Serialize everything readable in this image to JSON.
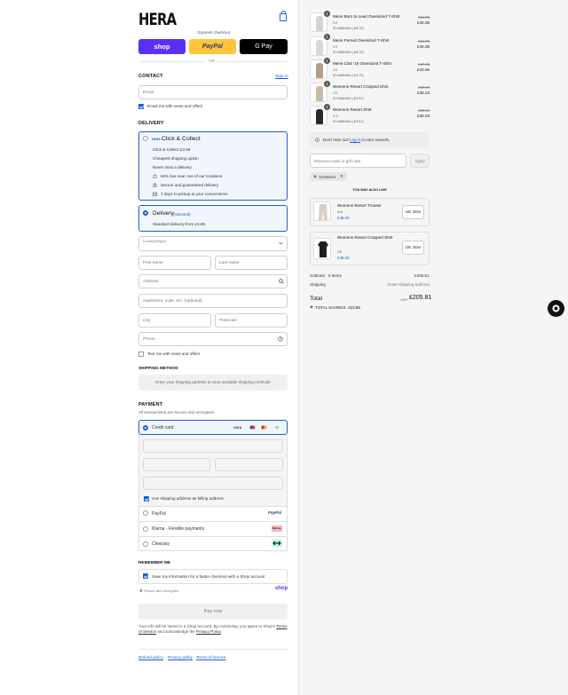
{
  "brand": {
    "logo": "HERA"
  },
  "express": {
    "label": "Express checkout",
    "shop": "shop",
    "paypal": "PayPal",
    "gpay": "G Pay",
    "or": "OR"
  },
  "contact": {
    "title": "CONTACT",
    "sign_in": "Sign in",
    "email_placeholder": "Email",
    "news_label": "Email me with news and offers"
  },
  "delivery": {
    "title": "DELIVERY",
    "cc": {
      "badge": "HERA",
      "label": "Click & Collect",
      "lines": [
        "Click & Collect £3.99",
        "Cheapest shipping option",
        "Never miss a delivery"
      ],
      "features": [
        "94% live near one of our locations",
        "Secure and guaranteed delivery",
        "7 days to pickup at your convenience"
      ]
    },
    "del": {
      "label": "Delivery",
      "selected": "(selected)",
      "line": "Standard delivery from £3.89"
    },
    "country_label": "Country/Region",
    "first_name": "First name",
    "last_name": "Last name",
    "address": "Address",
    "apartment": "Apartment, suite, etc. (optional)",
    "city": "City",
    "postcode": "Postcode",
    "phone": "Phone",
    "text_me": "Text me with news and offers"
  },
  "shipping": {
    "title": "SHIPPING METHOD",
    "msg": "Enter your shipping address to view available shipping methods"
  },
  "payment": {
    "title": "PAYMENT",
    "subtitle": "All transactions are secure and encrypted.",
    "credit_card": "Credit card",
    "more_cards": "+5",
    "billing_label": "Use shipping address as billing address",
    "paypal": "PayPal",
    "paypal_logo": "PayPal",
    "klarna": "Klarna - Flexible payments",
    "klarna_logo": "Klarna.",
    "clearpay": "Clearpay"
  },
  "remember": {
    "title": "REMEMBER ME",
    "save_label": "Save my information for a faster checkout with a Shop account",
    "secure": "Secure and encrypted",
    "shop": "shop"
  },
  "pay_now": "Pay now",
  "legal": {
    "text1": "Your info will be saved to a Shop account. By continuing, you agree to Shop's",
    "tos": "Terms of Service",
    "text2": "and acknowledge the",
    "privacy": "Privacy Policy",
    "dot": "."
  },
  "footer": {
    "refund": "Refund policy",
    "privacy": "Privacy policy",
    "terms": "Terms of service"
  },
  "cart": {
    "items": [
      {
        "qty": "1",
        "name": "Mens Born to Lead Oversized T-Shirt",
        "size": "XS",
        "old": "£51.95",
        "price": "£46.35",
        "discount": "HANNAH (-£5.70)"
      },
      {
        "qty": "1",
        "name": "Mens Pursuit Oversized T-Shirt",
        "size": "XS",
        "old": "£51.95",
        "price": "£46.35",
        "discount": "HANNAH (-£5.70)"
      },
      {
        "qty": "1",
        "name": "Mens Club '15 Oversized T-Shirt",
        "size": "XS",
        "old": "£47.35",
        "price": "£42.65",
        "discount": "HANNAH (-£4.70)"
      },
      {
        "qty": "1",
        "name": "Womens Resort Cropped Shirt",
        "size": "XS",
        "old": "£39.14",
        "price": "£35.23",
        "discount": "HANNAH (-£3.91)"
      },
      {
        "qty": "1",
        "name": "Womens Resort Shirt",
        "size": "6-8",
        "old": "£39.14",
        "price": "£35.23",
        "discount": "HANNAH (-£3.91)"
      }
    ],
    "rewards": {
      "pre": "Don't miss out!",
      "link": "Log in",
      "post": "to earn rewards."
    },
    "discount_placeholder": "Discount code or gift card",
    "apply": "Apply",
    "code_tag": "HANNAH",
    "also_like": "YOU MAY ALSO LIKE",
    "recs": [
      {
        "name": "Womens Resort Trouser",
        "size": "6-8",
        "price": "£48.00",
        "btn": "UK Size"
      },
      {
        "name": "Womens Resort Cropped Shirt",
        "size": "XS",
        "price": "£38.00",
        "btn": "UK Size"
      }
    ],
    "subtotal_label": "Subtotal · 5 items",
    "subtotal": "£205.81",
    "shipping_label": "Shipping",
    "shipping_val": "Enter shipping address",
    "total_label": "Total",
    "currency": "GBP",
    "total": "£205.81",
    "savings_label": "TOTAL SAVINGS",
    "savings": "£23.85"
  }
}
